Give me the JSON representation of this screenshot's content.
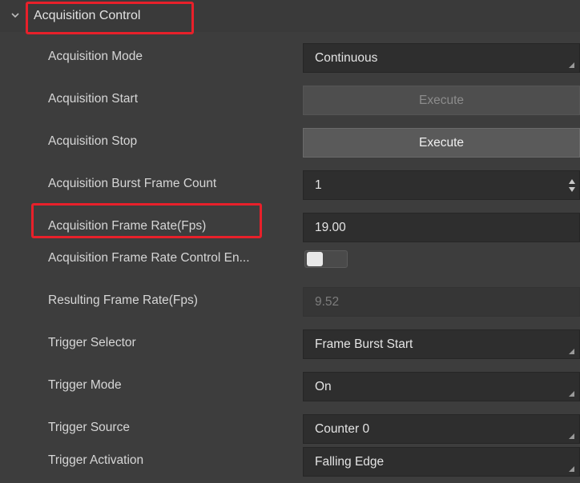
{
  "group": {
    "title": "Acquisition Control",
    "expanded_icon": "chevron-down-icon"
  },
  "highlight_color": "#e8202a",
  "rows": [
    {
      "label": "Acquisition Mode",
      "type": "combo",
      "value": "Continuous"
    },
    {
      "label": "Acquisition Start",
      "type": "button",
      "value": "Execute",
      "enabled": false
    },
    {
      "label": "Acquisition Stop",
      "type": "button",
      "value": "Execute",
      "enabled": true
    },
    {
      "label": "Acquisition Burst Frame Count",
      "type": "spin",
      "value": "1"
    },
    {
      "label": "Acquisition Frame Rate(Fps)",
      "type": "field",
      "value": "19.00"
    },
    {
      "label": "Acquisition Frame Rate Control En...",
      "type": "toggle",
      "value": "off"
    },
    {
      "label": "Resulting Frame Rate(Fps)",
      "type": "readonly",
      "value": "9.52"
    },
    {
      "label": "Trigger Selector",
      "type": "combo",
      "value": "Frame Burst Start"
    },
    {
      "label": "Trigger Mode",
      "type": "combo",
      "value": "On"
    },
    {
      "label": "Trigger Source",
      "type": "combo",
      "value": "Counter 0"
    },
    {
      "label": "Trigger Activation",
      "type": "combo",
      "value": "Falling Edge"
    }
  ]
}
